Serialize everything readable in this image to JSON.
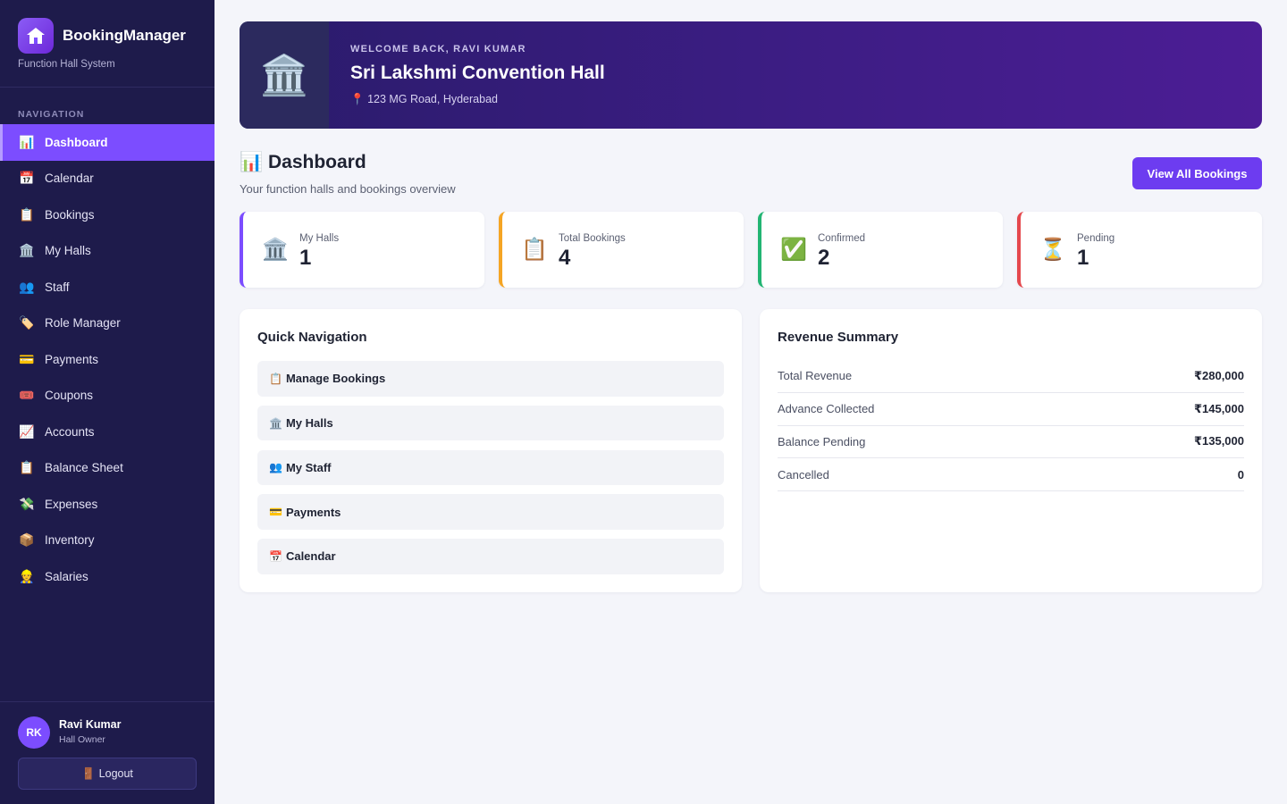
{
  "brand": {
    "name": "BookingManager",
    "subtitle": "Function Hall System"
  },
  "sidebar": {
    "nav_label": "NAVIGATION",
    "items": [
      {
        "label": "Dashboard",
        "icon": "📊",
        "active": true
      },
      {
        "label": "Calendar",
        "icon": "📅"
      },
      {
        "label": "Bookings",
        "icon": "📋"
      },
      {
        "label": "My Halls",
        "icon": "🏛️"
      },
      {
        "label": "Staff",
        "icon": "👥"
      },
      {
        "label": "Role Manager",
        "icon": "🏷️"
      },
      {
        "label": "Payments",
        "icon": "💳"
      },
      {
        "label": "Coupons",
        "icon": "🎟️"
      },
      {
        "label": "Accounts",
        "icon": "📈"
      },
      {
        "label": "Balance Sheet",
        "icon": "📋"
      },
      {
        "label": "Expenses",
        "icon": "💸"
      },
      {
        "label": "Inventory",
        "icon": "📦"
      },
      {
        "label": "Salaries",
        "icon": "👷"
      }
    ]
  },
  "user": {
    "initials": "RK",
    "name": "Ravi Kumar",
    "role": "Hall Owner",
    "logout_label": "Logout",
    "logout_icon": "🚪"
  },
  "hero": {
    "icon": "🏛️",
    "welcome": "WELCOME BACK, RAVI KUMAR",
    "title": "Sri Lakshmi Convention Hall",
    "location_icon": "📍",
    "location": "123 MG Road, Hyderabad"
  },
  "page": {
    "title_icon": "📊",
    "title": "Dashboard",
    "subtitle": "Your function halls and bookings overview",
    "view_all_label": "View All Bookings"
  },
  "stats": [
    {
      "label": "My Halls",
      "value": "1",
      "icon": "🏛️",
      "color": "#7c4dff"
    },
    {
      "label": "Total Bookings",
      "value": "4",
      "icon": "📋",
      "color": "#f5a524"
    },
    {
      "label": "Confirmed",
      "value": "2",
      "icon": "✅",
      "color": "#22b573"
    },
    {
      "label": "Pending",
      "value": "1",
      "icon": "⏳",
      "color": "#e5484d"
    }
  ],
  "quick_nav": {
    "title": "Quick Navigation",
    "items": [
      {
        "label": "Manage Bookings",
        "icon": "📋"
      },
      {
        "label": "My Halls",
        "icon": "🏛️"
      },
      {
        "label": "My Staff",
        "icon": "👥"
      },
      {
        "label": "Payments",
        "icon": "💳"
      },
      {
        "label": "Calendar",
        "icon": "📅"
      }
    ]
  },
  "revenue": {
    "title": "Revenue Summary",
    "rows": [
      {
        "label": "Total Revenue",
        "value": "₹280,000"
      },
      {
        "label": "Advance Collected",
        "value": "₹145,000"
      },
      {
        "label": "Balance Pending",
        "value": "₹135,000"
      },
      {
        "label": "Cancelled",
        "value": "0"
      }
    ]
  }
}
